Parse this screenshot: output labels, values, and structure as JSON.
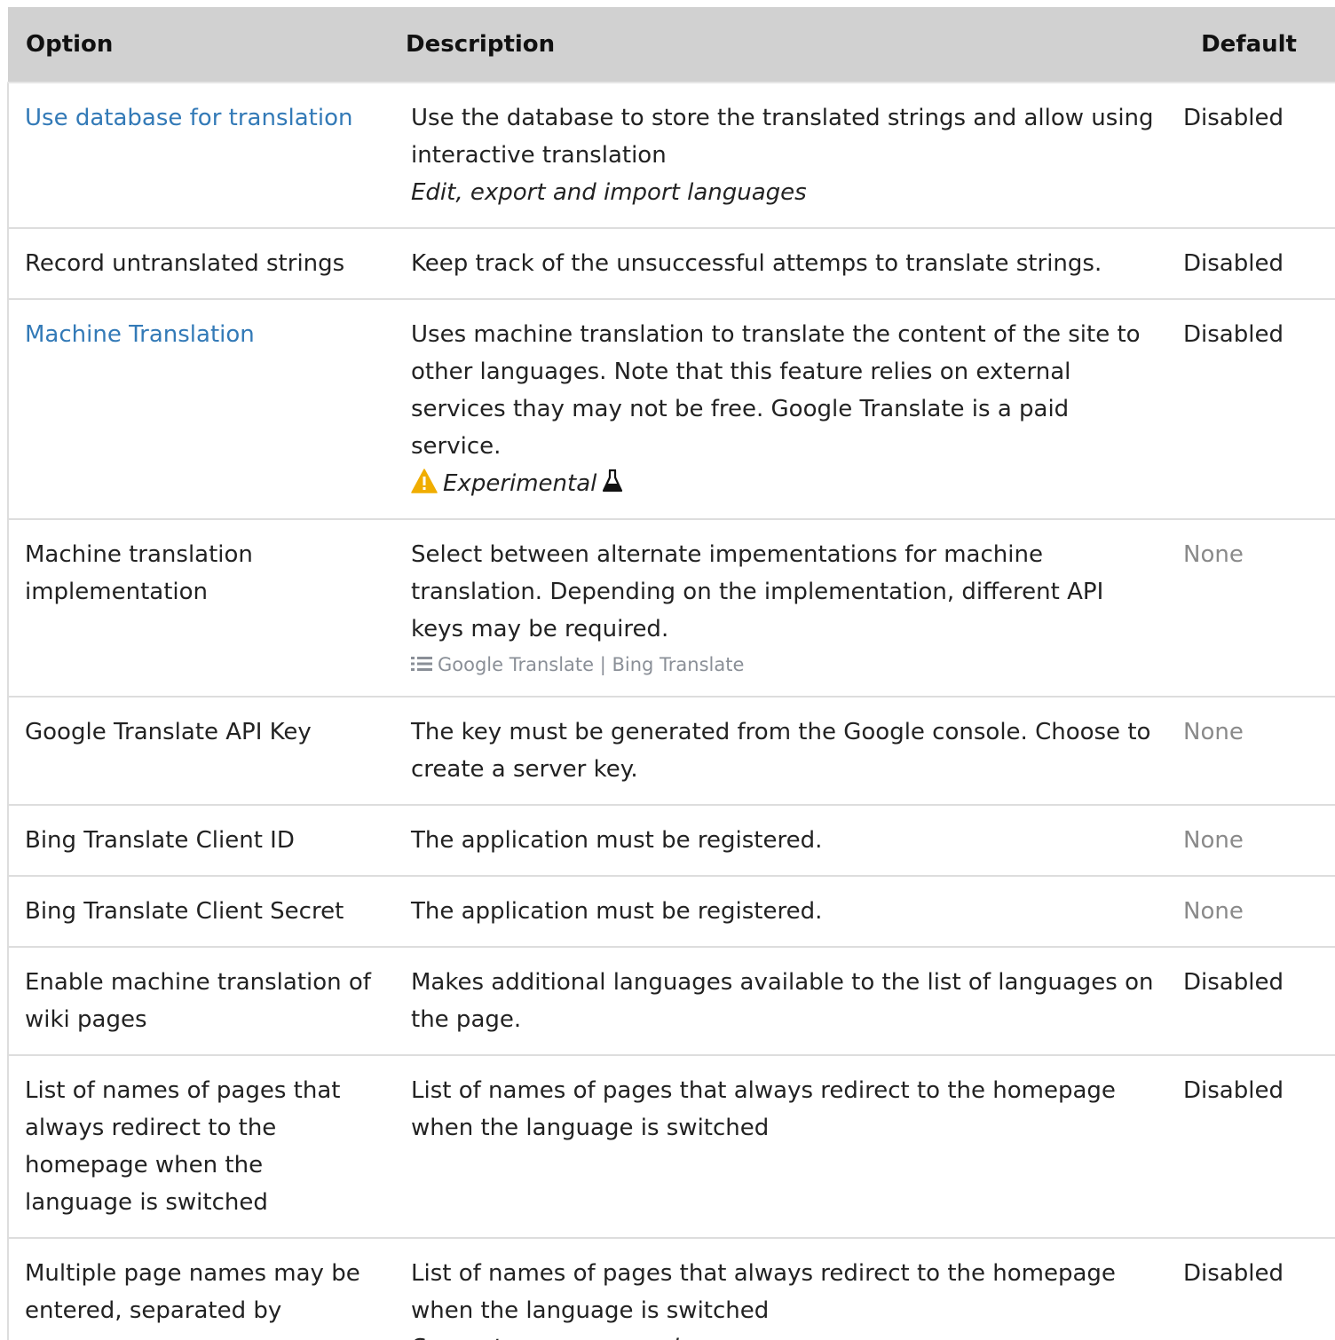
{
  "table": {
    "headers": {
      "option": "Option",
      "description": "Description",
      "default": "Default"
    },
    "rows": [
      {
        "option": "Use database for translation",
        "option_is_link": true,
        "description": "Use the database to store the translated strings and allow using interactive translation",
        "hint": "Edit, export and import languages",
        "default": "Disabled"
      },
      {
        "option": "Record untranslated strings",
        "description": "Keep track of the unsuccessful attemps to translate strings.",
        "default": "Disabled"
      },
      {
        "option": "Machine Translation",
        "option_is_link": true,
        "description": "Uses machine translation to translate the content of the site to other languages. Note that this feature relies on external services thay may not be free. Google Translate is a paid service.",
        "tag": "Experimental",
        "tag_icons": [
          "warning-icon",
          "flask-icon"
        ],
        "default": "Disabled"
      },
      {
        "option": "Machine translation implementation",
        "description": "Select between alternate impementations for machine translation. Depending on the implementation, different API keys may be required.",
        "options_text": "Google Translate | Bing Translate",
        "options_icon": "list-icon",
        "default": "None"
      },
      {
        "option": "Google Translate API Key",
        "description": "The key must be generated from the Google console. Choose to create a server key.",
        "default": "None"
      },
      {
        "option": "Bing Translate Client ID",
        "description": "The application must be registered.",
        "default": "None"
      },
      {
        "option": "Bing Translate Client Secret",
        "description": "The application must be registered.",
        "default": "None"
      },
      {
        "option": "Enable machine translation of wiki pages",
        "description": "Makes additional languages available to the list of languages on the page.",
        "default": "Disabled"
      },
      {
        "option": "List of names of pages that always redirect to the homepage when the language is switched",
        "description": "List of names of pages that always redirect to the homepage when the language is switched",
        "default": "Disabled"
      },
      {
        "option": "Multiple page names may be entered, separated by commas",
        "description": "List of names of pages that always redirect to the homepage when the language is switched",
        "hint": "Separate page names by commas",
        "default": "Disabled"
      }
    ]
  },
  "colors": {
    "header_bg": "#d1d1d1",
    "link": "#337ab7",
    "muted": "#8a8a8a",
    "warning": "#f0ad00"
  }
}
